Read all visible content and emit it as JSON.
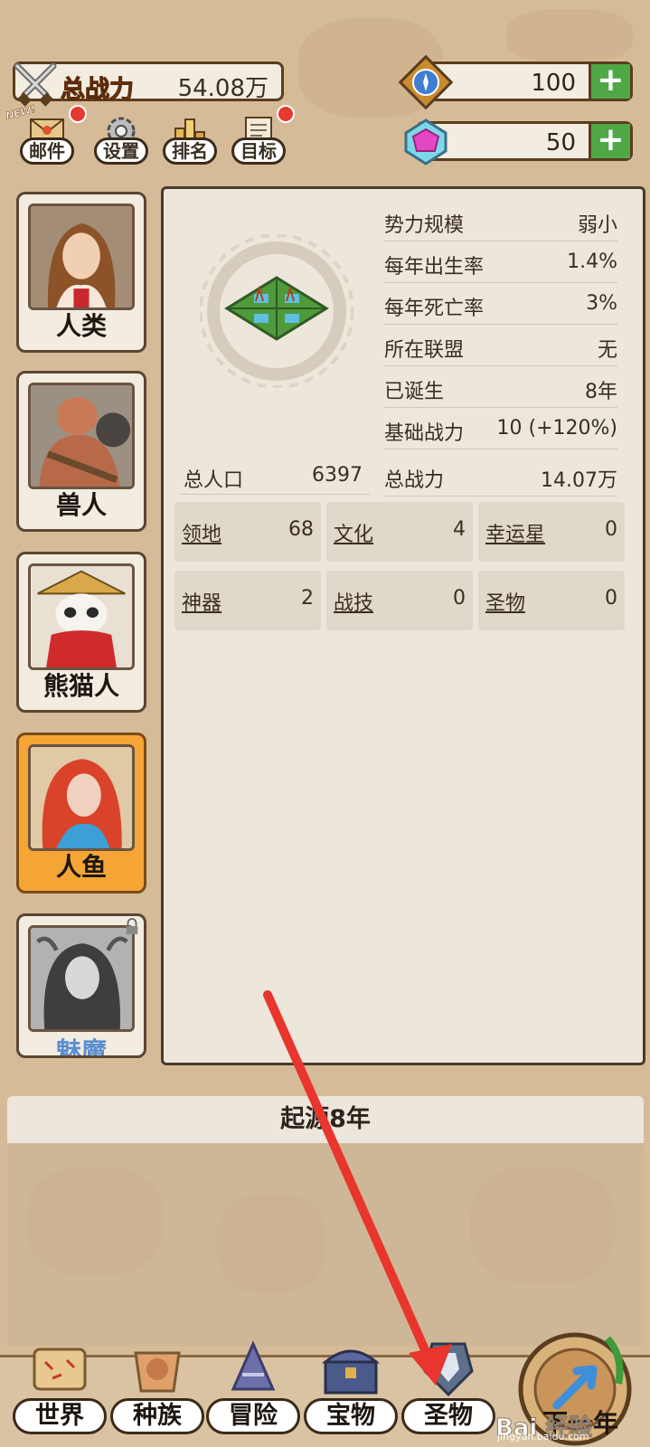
{
  "top": {
    "power_label": "总战力",
    "power_value": "54.08万",
    "gems_value": "100",
    "crystals_value": "50",
    "plus_label": "+",
    "new_badge": "NEW!"
  },
  "menu": [
    {
      "label": "邮件",
      "icon": "mail-icon"
    },
    {
      "label": "设置",
      "icon": "gear-icon"
    },
    {
      "label": "排名",
      "icon": "ranking-icon"
    },
    {
      "label": "目标",
      "icon": "goal-icon"
    }
  ],
  "races": [
    {
      "name": "人类",
      "active": false,
      "locked": false
    },
    {
      "name": "兽人",
      "active": false,
      "locked": false
    },
    {
      "name": "熊猫人",
      "active": false,
      "locked": false
    },
    {
      "name": "人鱼",
      "active": true,
      "locked": false
    },
    {
      "name": "魅魔",
      "active": false,
      "locked": true
    }
  ],
  "stats": [
    {
      "key": "势力规模",
      "value": "弱小"
    },
    {
      "key": "每年出生率",
      "value": "1.4%"
    },
    {
      "key": "每年死亡率",
      "value": "3%"
    },
    {
      "key": "所在联盟",
      "value": "无"
    },
    {
      "key": "已诞生",
      "value": "8年"
    },
    {
      "key": "基础战力",
      "value": "10 (+120%)"
    },
    {
      "key": "总战力",
      "value": "14.07万"
    }
  ],
  "population": {
    "key": "总人口",
    "value": "6397"
  },
  "cells": [
    {
      "key": "领地",
      "value": "68"
    },
    {
      "key": "文化",
      "value": "4"
    },
    {
      "key": "幸运星",
      "value": "0"
    },
    {
      "key": "神器",
      "value": "2"
    },
    {
      "key": "战技",
      "value": "0"
    },
    {
      "key": "圣物",
      "value": "0"
    }
  ],
  "year_bar": "起源8年",
  "bottom_nav": [
    {
      "label": "世界",
      "icon": "world-map-icon"
    },
    {
      "label": "种族",
      "icon": "race-icon"
    },
    {
      "label": "冒险",
      "icon": "adventure-icon"
    },
    {
      "label": "宝物",
      "icon": "treasure-chest-icon"
    },
    {
      "label": "圣物",
      "icon": "relic-icon"
    }
  ],
  "next_label": "下一年",
  "watermark": "Bai 经验",
  "watermark_sub": "jingyan.baidu.com",
  "colors": {
    "background": "#d6bb98",
    "panel": "#ede6da",
    "active_card": "#f4a535",
    "plus_green": "#4fa845",
    "annotation_arrow": "#e8352d"
  }
}
